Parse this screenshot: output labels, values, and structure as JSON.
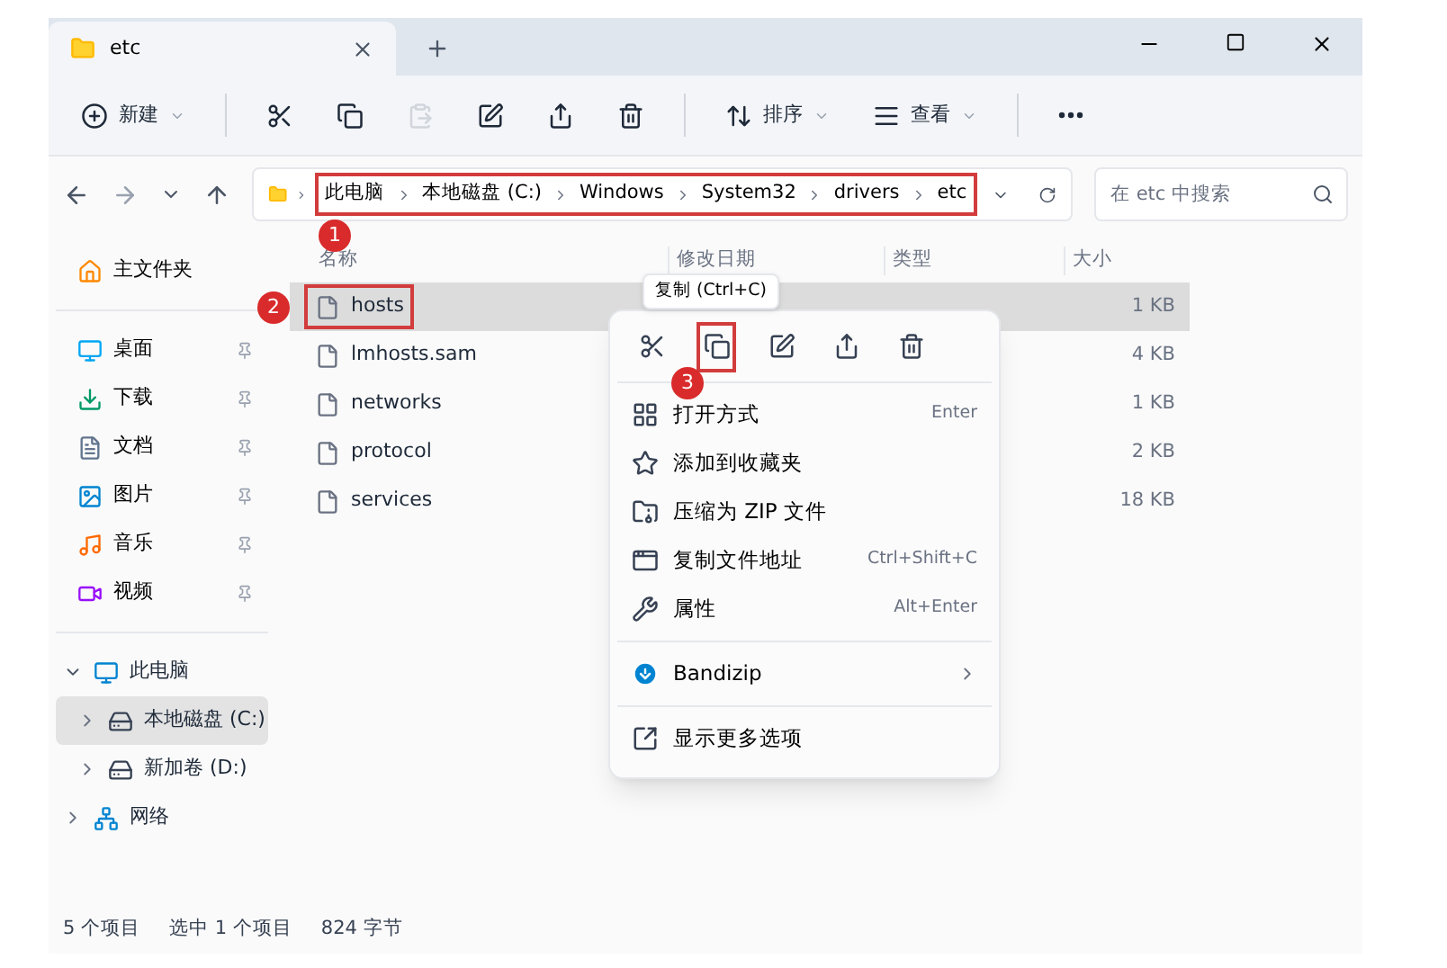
{
  "window": {
    "tab_title": "etc"
  },
  "toolbar": [
    {
      "kind": "new",
      "label": "新建",
      "disabled": false
    },
    {
      "kind": "cut",
      "disabled": false
    },
    {
      "kind": "copy",
      "disabled": false
    },
    {
      "kind": "paste",
      "disabled": true
    },
    {
      "kind": "rename",
      "disabled": false
    },
    {
      "kind": "share",
      "disabled": false
    },
    {
      "kind": "delete",
      "disabled": false
    },
    {
      "kind": "sort",
      "label": "排序",
      "disabled": false
    },
    {
      "kind": "view",
      "label": "查看",
      "disabled": false
    },
    {
      "kind": "more",
      "disabled": false
    }
  ],
  "address": {
    "breadcrumbs": [
      "此电脑",
      "本地磁盘 (C:)",
      "Windows",
      "System32",
      "drivers",
      "etc"
    ],
    "annotation": "1",
    "search_placeholder": "在 etc 中搜索"
  },
  "sidebar": {
    "home": "主文件夹",
    "quick_access": [
      {
        "kind": "desktop",
        "label": "桌面",
        "pinned": true
      },
      {
        "kind": "downloads",
        "label": "下载",
        "pinned": true
      },
      {
        "kind": "documents",
        "label": "文档",
        "pinned": true
      },
      {
        "kind": "pictures",
        "label": "图片",
        "pinned": true
      },
      {
        "kind": "music",
        "label": "音乐",
        "pinned": true
      },
      {
        "kind": "videos",
        "label": "视频",
        "pinned": true
      }
    ],
    "tree": [
      {
        "kind": "pc",
        "label": "此电脑",
        "expanded": true,
        "selected": false,
        "children": [
          {
            "kind": "drive",
            "label": "本地磁盘 (C:)",
            "expanded": false,
            "selected": true
          },
          {
            "kind": "drive",
            "label": "新加卷 (D:)",
            "expanded": false,
            "selected": false
          }
        ]
      },
      {
        "kind": "network",
        "label": "网络",
        "expanded": false,
        "selected": false
      }
    ]
  },
  "file_list": {
    "columns": [
      "名称",
      "修改日期",
      "类型",
      "大小"
    ],
    "rows": [
      {
        "name": "hosts",
        "size": "1 KB",
        "selected": true,
        "annotation": "2"
      },
      {
        "name": "lmhosts.sam",
        "size": "4 KB",
        "selected": false
      },
      {
        "name": "networks",
        "size": "1 KB",
        "selected": false
      },
      {
        "name": "protocol",
        "size": "2 KB",
        "selected": false
      },
      {
        "name": "services",
        "size": "18 KB",
        "selected": false
      }
    ]
  },
  "context_menu": {
    "tooltip": "复制 (Ctrl+C)",
    "actions": [
      {
        "kind": "cut"
      },
      {
        "kind": "copy",
        "annotation": "3"
      },
      {
        "kind": "rename"
      },
      {
        "kind": "share"
      },
      {
        "kind": "delete"
      }
    ],
    "sections": [
      [
        {
          "kind": "open_with",
          "label": "打开方式",
          "shortcut": "Enter"
        },
        {
          "kind": "favorite",
          "label": "添加到收藏夹"
        },
        {
          "kind": "zip",
          "label": "压缩为 ZIP 文件"
        },
        {
          "kind": "copy_path",
          "label": "复制文件地址",
          "shortcut": "Ctrl+Shift+C"
        },
        {
          "kind": "properties",
          "label": "属性",
          "shortcut": "Alt+Enter"
        }
      ],
      [
        {
          "kind": "bandizip",
          "label": "Bandizip",
          "submenu": true
        }
      ],
      [
        {
          "kind": "more_options",
          "label": "显示更多选项"
        }
      ]
    ]
  },
  "status_bar": [
    "5 个项目",
    "选中 1 个项目",
    "824 字节"
  ]
}
